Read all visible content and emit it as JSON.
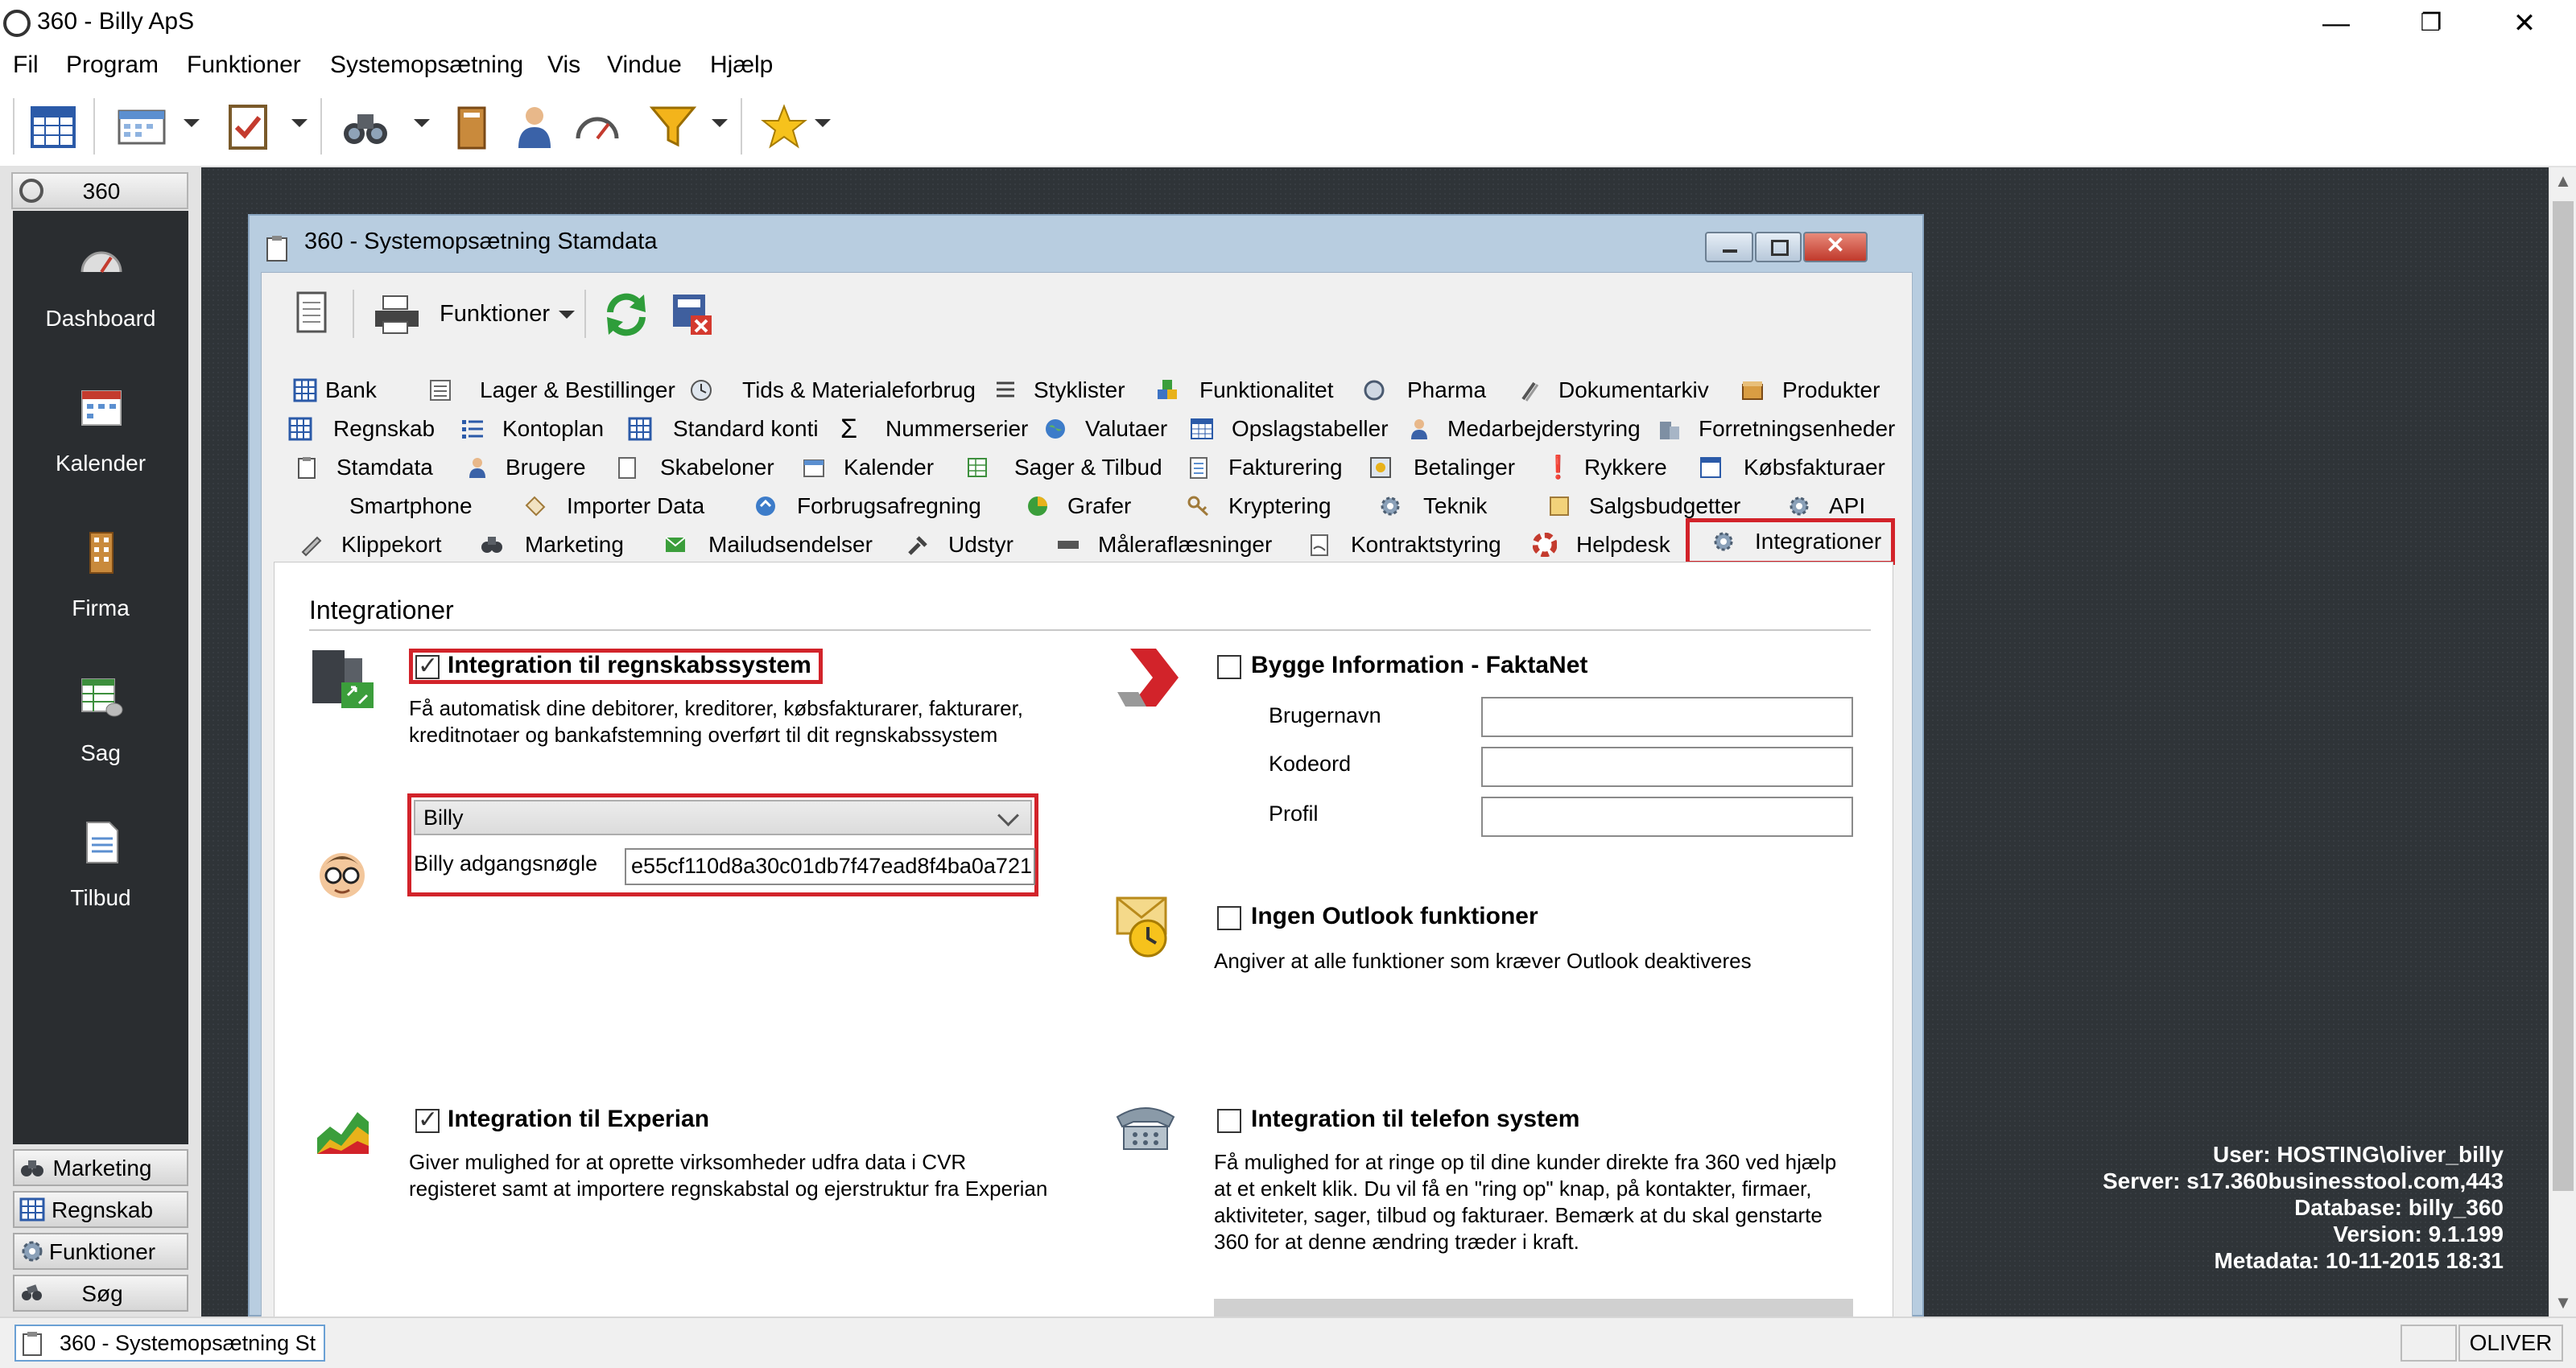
{
  "window": {
    "title": "360 - Billy ApS",
    "minimize_glyph": "—",
    "maximize_glyph": "❐",
    "close_glyph": "✕"
  },
  "menu": [
    "Fil",
    "Program",
    "Funktioner",
    "Systemopsætning",
    "Vis",
    "Vindue",
    "Hjælp"
  ],
  "toolbar_icons": [
    "calendar-grid-icon",
    "calendar-icon",
    "checklist-icon",
    "binoculars-icon",
    "book-icon",
    "person-icon",
    "gauge-icon",
    "filter-icon",
    "star-icon"
  ],
  "nav": {
    "header": "360",
    "big_items": [
      {
        "label": "Dashboard",
        "icon": "gauge-icon"
      },
      {
        "label": "Kalender",
        "icon": "calendar-icon"
      },
      {
        "label": "Firma",
        "icon": "building-icon"
      },
      {
        "label": "Sag",
        "icon": "folder-icon"
      },
      {
        "label": "Tilbud",
        "icon": "document-icon"
      }
    ],
    "small_items": [
      {
        "label": "Marketing",
        "icon": "binoculars-icon"
      },
      {
        "label": "Regnskab",
        "icon": "grid-icon"
      },
      {
        "label": "Funktioner",
        "icon": "gear-icon"
      },
      {
        "label": "Søg",
        "icon": "search-icon"
      }
    ]
  },
  "child_window": {
    "title": "360 - Systemopsætning Stamdata",
    "toolbar_funktioner": "Funktioner"
  },
  "tabs": {
    "row1": [
      "Bank",
      "Lager & Bestillinger",
      "Tids & Materialeforbrug",
      "Styklister",
      "Funktionalitet",
      "Pharma",
      "Dokumentarkiv",
      "Produkter"
    ],
    "row2": [
      "Regnskab",
      "Kontoplan",
      "Standard konti",
      "Nummerserier",
      "Valutaer",
      "Opslagstabeller",
      "Medarbejderstyring",
      "Forretningsenheder"
    ],
    "row3": [
      "Stamdata",
      "Brugere",
      "Skabeloner",
      "Kalender",
      "Sager & Tilbud",
      "Fakturering",
      "Betalinger",
      "Rykkere",
      "Købsfakturaer"
    ],
    "row4": [
      "Smartphone",
      "Importer Data",
      "Forbrugsafregning",
      "Grafer",
      "Kryptering",
      "Teknik",
      "Salgsbudgetter",
      "API"
    ],
    "row5": [
      "Klippekort",
      "Marketing",
      "Mailudsendelser",
      "Udstyr",
      "Måleraflæsninger",
      "Kontraktstyring",
      "Helpdesk",
      "Integrationer"
    ]
  },
  "content": {
    "section_title": "Integrationer",
    "regnskab": {
      "label": "Integration til regnskabssystem",
      "checked": true,
      "desc_line1": "Få automatisk dine debitorer, kreditorer, købsfakturarer, fakturarer,",
      "desc_line2": "kreditnotaer og bankafstemning overført til dit regnskabssystem",
      "system": "Billy",
      "key_label": "Billy adgangsnøgle",
      "key_value": "e55cf110d8a30c01db7f47ead8f4ba0a721"
    },
    "faktanet": {
      "label": "Bygge Information - FaktaNet",
      "checked": false,
      "user_label": "Brugernavn",
      "code_label": "Kodeord",
      "profile_label": "Profil"
    },
    "outlook": {
      "label": "Ingen Outlook funktioner",
      "checked": false,
      "desc": "Angiver at alle funktioner som kræver Outlook deaktiveres"
    },
    "experian": {
      "label": "Integration til Experian",
      "checked": true,
      "desc_line1": "Giver mulighed for at oprette virksomheder udfra data i CVR",
      "desc_line2": "registeret samt at importere regnskabstal og ejerstruktur fra Experian"
    },
    "telefon": {
      "label": "Integration til telefon system",
      "checked": false,
      "desc_line1": "Få mulighed for at ringe op til dine kunder direkte fra 360 ved hjælp",
      "desc_line2": "at et enkelt klik. Du vil få en \"ring op\" knap, på kontakter, firmaer,",
      "desc_line3": "aktiviteter, sager, tilbud og fakturaer. Bemærk at du skal genstarte",
      "desc_line4": "360 for at denne ændring træder i kraft."
    }
  },
  "server_info": [
    "User: HOSTING\\oliver_billy",
    "Server: s17.360businesstool.com,443",
    "Database: billy_360",
    "Version: 9.1.199",
    "Metadata: 10-11-2015 18:31"
  ],
  "statusbar": {
    "task": "360 - Systemopsætning St",
    "user": "OLIVER"
  },
  "colors": {
    "highlight_red": "#d2232a",
    "workspace": "#2f3438",
    "nav_dark": "#2a2d30",
    "window_frame": "#b8cde0"
  }
}
